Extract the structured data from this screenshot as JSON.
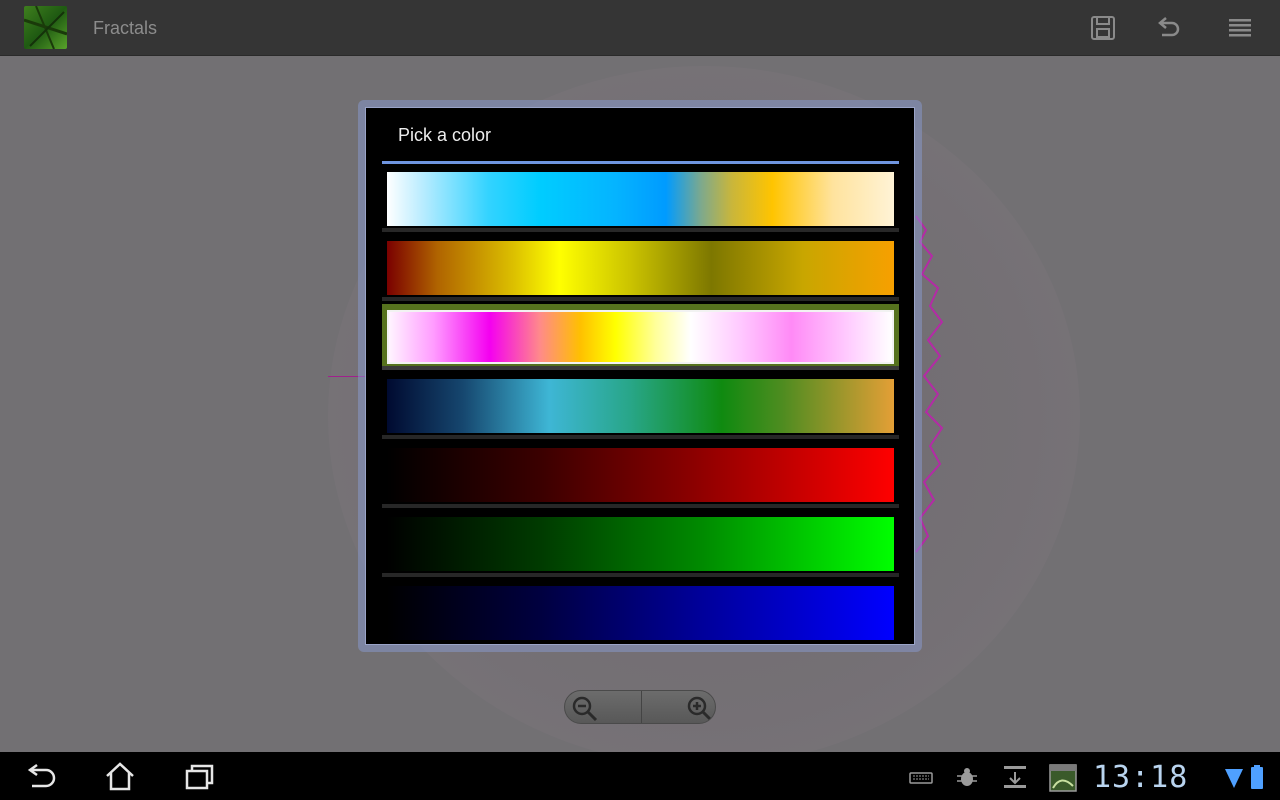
{
  "action_bar": {
    "app_title": "Fractals",
    "app_icon": "leaf-app-icon",
    "actions": [
      {
        "name": "save",
        "icon": "floppy-disk-icon"
      },
      {
        "name": "undo",
        "icon": "undo-arrow-icon"
      },
      {
        "name": "menu",
        "icon": "overflow-menu-icon"
      }
    ]
  },
  "dialog": {
    "title": "Pick a color",
    "accent": "#6f95e0",
    "selected_index": 2,
    "palettes": [
      {
        "name": "white-cyan-blue-gold",
        "colors": [
          "#ffffff",
          "#00cdff",
          "#009bff",
          "#ffc400",
          "#fff3d6"
        ]
      },
      {
        "name": "maroon-yellow-olive-orange",
        "colors": [
          "#7a0000",
          "#ffff00",
          "#7d7700",
          "#f7a000"
        ]
      },
      {
        "name": "white-magenta-yellow-pink",
        "colors": [
          "#fff4ff",
          "#f400f0",
          "#ffff00",
          "#ffffff",
          "#ff8af6",
          "#ffffff"
        ]
      },
      {
        "name": "navy-teal-green-orange",
        "colors": [
          "#000a30",
          "#3eb6d5",
          "#0f8a10",
          "#e49f36"
        ]
      },
      {
        "name": "black-red",
        "colors": [
          "#000000",
          "#ff0000"
        ]
      },
      {
        "name": "black-green",
        "colors": [
          "#000000",
          "#00ff00"
        ]
      },
      {
        "name": "black-blue",
        "colors": [
          "#000000",
          "#0000ff"
        ]
      }
    ]
  },
  "zoom_controls": {
    "zoom_out_icon": "zoom-out-icon",
    "zoom_in_icon": "zoom-in-icon"
  },
  "system_bar": {
    "clock": "13:18",
    "nav": [
      "back-icon",
      "home-icon",
      "recent-apps-icon"
    ],
    "tray": [
      "keyboard-icon",
      "debug-bug-icon",
      "download-icon",
      "screenshot-icon",
      "wifi-signal-icon",
      "battery-icon"
    ],
    "clock_color": "#b9d4ef"
  }
}
